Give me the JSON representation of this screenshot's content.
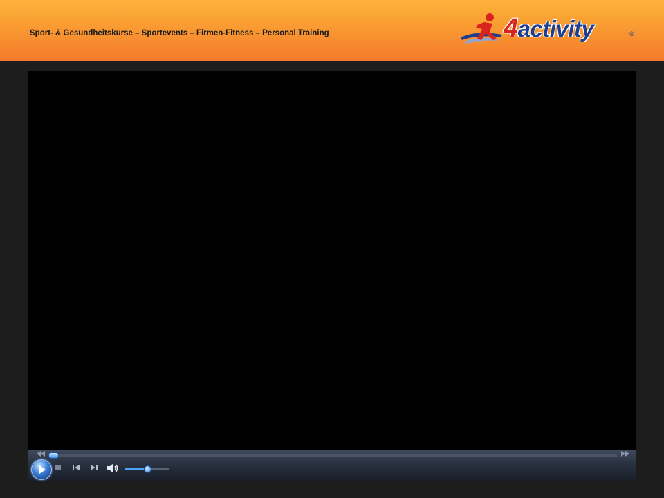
{
  "header": {
    "tagline": "Sport- & Gesundheitskurse – Sportevents – Firmen-Fitness – Personal Training",
    "logo": {
      "number": "4",
      "word": "activity",
      "registered": "®",
      "colors": {
        "number": "#d9231d",
        "word": "#1e3f8f",
        "figure_red": "#d9231d",
        "figure_blue": "#1e3f8f"
      }
    },
    "colors": {
      "gradient_top": "#fdb33a",
      "gradient_bottom": "#f47a2b"
    }
  },
  "player": {
    "video_background": "#000000",
    "seek_progress": 0.0,
    "volume_level": 0.5,
    "icons": {
      "rewind": "rewind-icon",
      "fast_forward": "fast-forward-icon",
      "play": "play-icon",
      "stop": "stop-icon",
      "previous": "previous-track-icon",
      "next": "next-track-icon",
      "volume": "speaker-icon"
    },
    "accent": "#3a8ce8"
  }
}
